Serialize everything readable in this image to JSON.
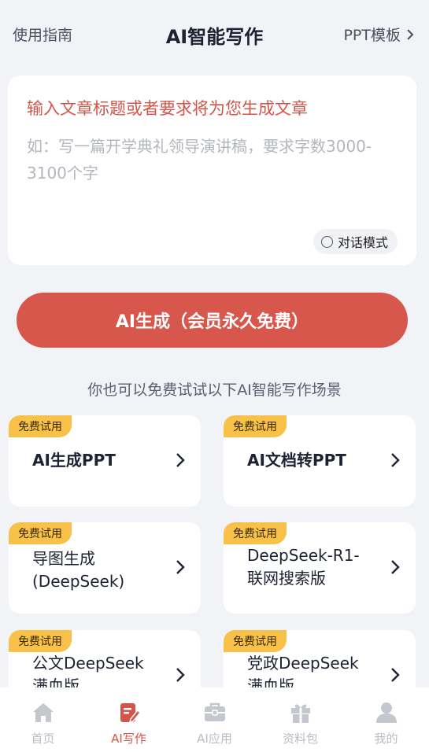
{
  "header": {
    "guide": "使用指南",
    "title": "AI智能写作",
    "ppt_link": "PPT模板"
  },
  "editor": {
    "heading": "输入文章标题或者要求将为您生成文章",
    "placeholder": "如：写一篇开学典礼领导演讲稿，要求字数3000-3100个字",
    "mode_label": "对话模式"
  },
  "generate_button": "AI生成（会员永久免费）",
  "subtitle": "你也可以免费试试以下AI智能写作场景",
  "badge_text": "免费试用",
  "cards": [
    {
      "line1": "AI生成PPT",
      "line2": ""
    },
    {
      "line1": "AI文档转PPT",
      "line2": ""
    },
    {
      "line1": "导图生成",
      "line2": "(DeepSeek)"
    },
    {
      "line1": "DeepSeek-R1-",
      "line2": "联网搜索版"
    },
    {
      "line1": "公文DeepSeek",
      "line2": "满血版"
    },
    {
      "line1": "党政DeepSeek",
      "line2": "满血版"
    }
  ],
  "tabs": [
    {
      "label": "首页",
      "icon": "home-icon"
    },
    {
      "label": "AI写作",
      "icon": "edit-icon"
    },
    {
      "label": "AI应用",
      "icon": "briefcase-icon"
    },
    {
      "label": "资料包",
      "icon": "gift-icon"
    },
    {
      "label": "我的",
      "icon": "user-icon"
    }
  ],
  "colors": {
    "accent": "#d8574c",
    "badge": "#f8c24a",
    "background": "#f2f3f7"
  }
}
